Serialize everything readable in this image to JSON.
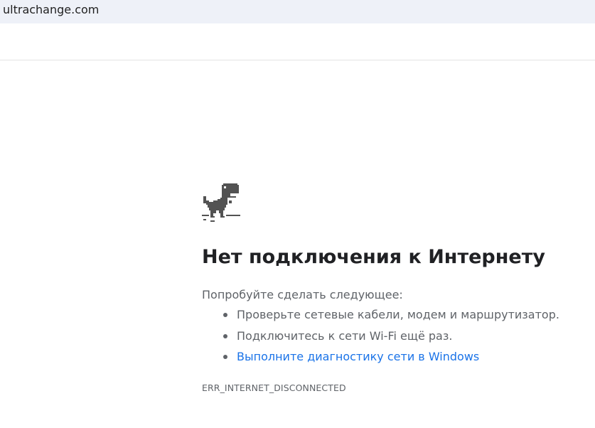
{
  "address_bar": {
    "url": "ultrachange.com"
  },
  "error_page": {
    "icon": "dino-offline-icon",
    "heading": "Нет подключения к Интернету",
    "suggestions_intro": "Попробуйте сделать следующее:",
    "suggestions": [
      {
        "text": "Проверьте сетевые кабели, модем и маршрутизатор."
      },
      {
        "text": "Подключитесь к сети Wi-Fi ещё раз."
      },
      {
        "text": "Выполните диагностику сети в Windows"
      }
    ],
    "error_code": "ERR_INTERNET_DISCONNECTED"
  },
  "colors": {
    "heading": "#202124",
    "body_text": "#5f6368",
    "link": "#1a73e8",
    "address_bar_bg": "#eef1f8"
  }
}
